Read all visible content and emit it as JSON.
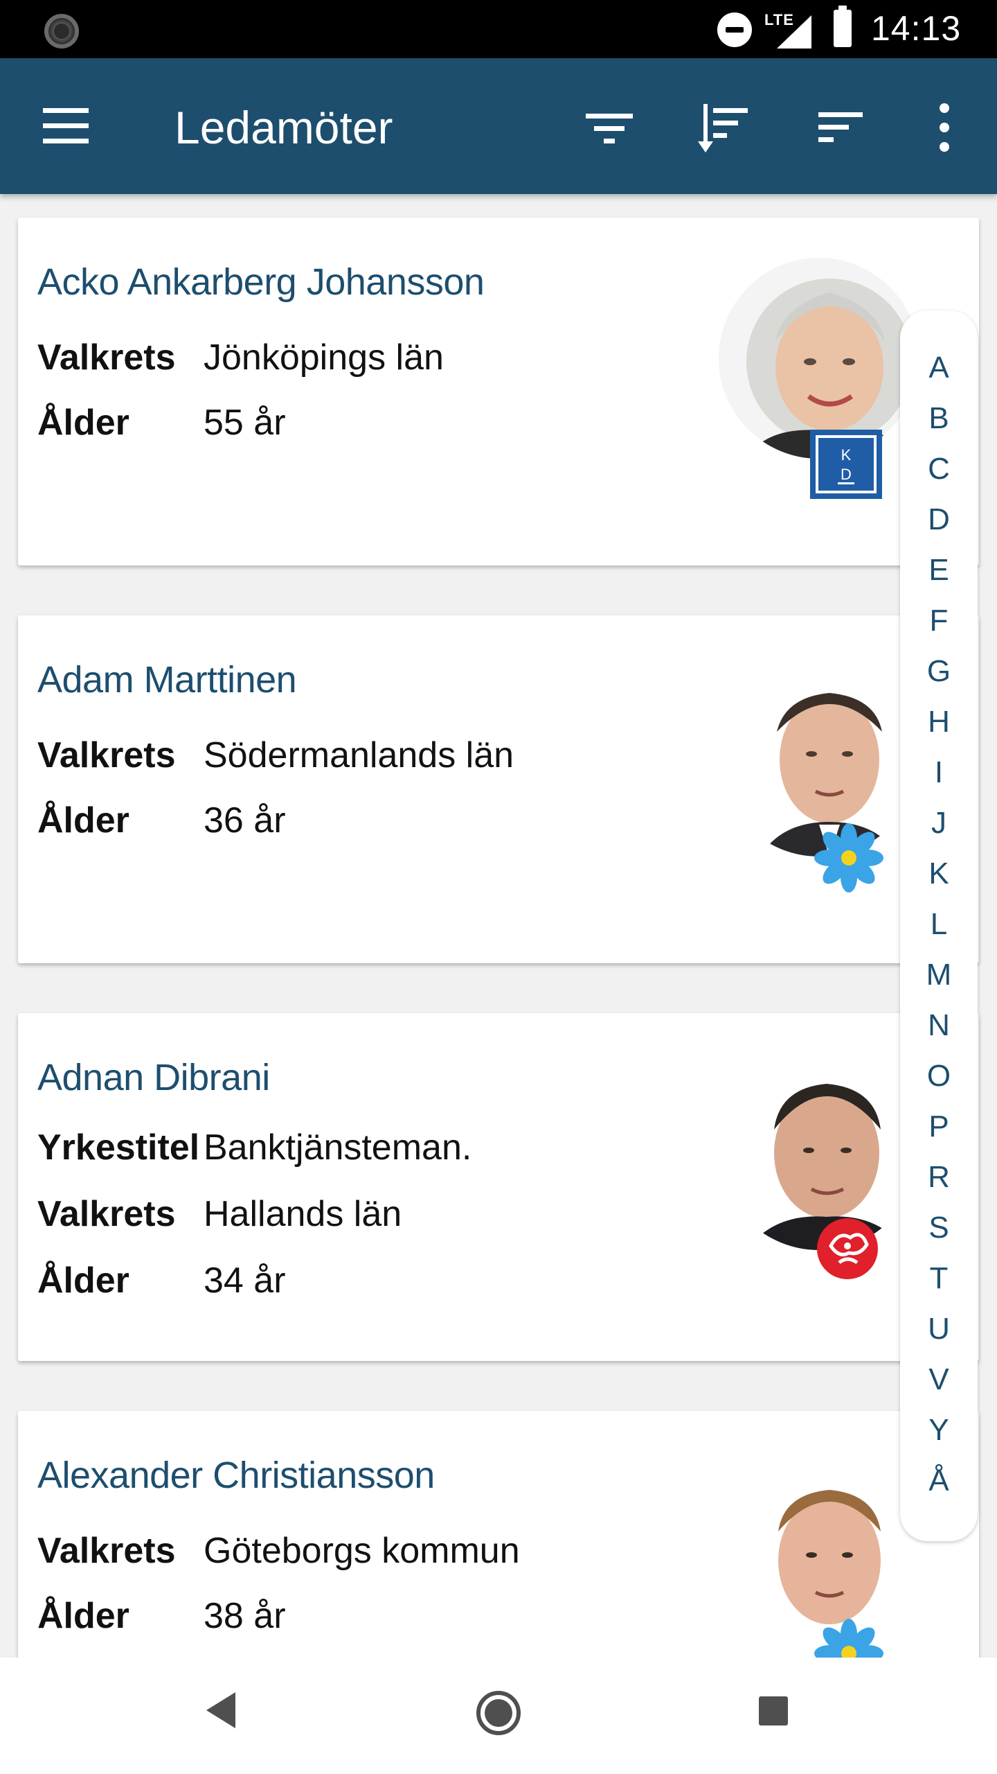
{
  "status_bar": {
    "network": "LTE",
    "time": "14:13"
  },
  "app_bar": {
    "title": "Ledamöter"
  },
  "members": [
    {
      "name": "Acko Ankarberg Johansson",
      "fields": [
        {
          "label": "Valkrets",
          "value": "Jönköpings län"
        },
        {
          "label": "Ålder",
          "value": "55 år"
        }
      ],
      "party_badge": {
        "icon": "kd-party-icon",
        "text_top": "K",
        "text_bottom": "D",
        "color": "#1f5da7"
      }
    },
    {
      "name": "Adam Marttinen",
      "fields": [
        {
          "label": "Valkrets",
          "value": "Södermanlands län"
        },
        {
          "label": "Ålder",
          "value": "36 år"
        }
      ],
      "party_badge": {
        "icon": "sd-flower-icon",
        "color": "#3aa4e6"
      }
    },
    {
      "name": "Adnan Dibrani",
      "fields": [
        {
          "label": "Yrkestitel",
          "value": "Banktjänsteman."
        },
        {
          "label": "Valkrets",
          "value": "Hallands län"
        },
        {
          "label": "Ålder",
          "value": "34 år"
        }
      ],
      "party_badge": {
        "icon": "s-rose-icon",
        "color": "#e0202a"
      }
    },
    {
      "name": "Alexander Christiansson",
      "fields": [
        {
          "label": "Valkrets",
          "value": "Göteborgs kommun"
        },
        {
          "label": "Ålder",
          "value": "38 år"
        }
      ],
      "party_badge": {
        "icon": "sd-flower-icon",
        "color": "#3aa4e6"
      }
    }
  ],
  "alphabet_index": [
    "A",
    "B",
    "C",
    "D",
    "E",
    "F",
    "G",
    "H",
    "I",
    "J",
    "K",
    "L",
    "M",
    "N",
    "O",
    "P",
    "R",
    "S",
    "T",
    "U",
    "V",
    "Y",
    "Å"
  ],
  "colors": {
    "primary": "#1d4e6e",
    "background": "#f1f1f1"
  }
}
